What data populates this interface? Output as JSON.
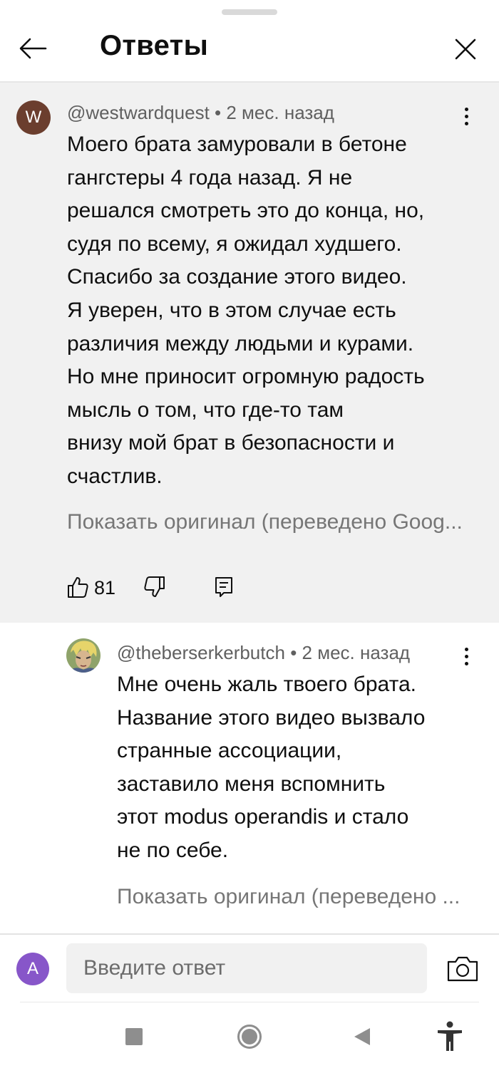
{
  "header": {
    "title": "Ответы",
    "back_icon": "arrow-left-icon",
    "close_icon": "close-icon"
  },
  "parent_comment": {
    "avatar_letter": "W",
    "avatar_color": "#6b3e2e",
    "author": "@westwardquest",
    "time": "2 мес. назад",
    "text_lines": [
      "Моего брата замуровали в бетоне",
      "гангстеры 4 года назад. Я не",
      "решался смотреть это до конца, но,",
      "судя по всему, я ожидал худшего.",
      "Спасибо за создание этого видео.",
      "Я уверен, что в этом случае есть",
      "различия между людьми и курами.",
      "Но мне приносит огромную радость",
      "мысль о том, что где-то там",
      "внизу мой брат в безопасности и",
      "счастлив."
    ],
    "show_original": "Показать оригинал (переведено Goog...",
    "like_count": "81"
  },
  "reply_comment": {
    "author": "@theberserkerbutch",
    "time": "2 мес. назад",
    "text_lines": [
      "Мне очень жаль твоего брата.",
      "Название этого видео вызвало",
      "странные ассоциации,",
      "заставило меня вспомнить",
      "этот modus operandis и стало",
      "не по себе."
    ],
    "show_original": "Показать оригинал (переведено ..."
  },
  "composer": {
    "avatar_letter": "A",
    "avatar_color": "#8756c9",
    "placeholder": "Введите ответ"
  },
  "navbar": {
    "items": [
      "stop-square-icon",
      "home-circle-icon",
      "back-triangle-icon",
      "accessibility-icon"
    ]
  }
}
